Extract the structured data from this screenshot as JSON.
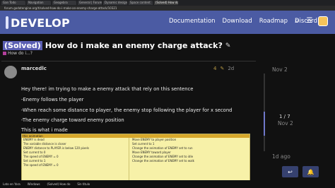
{
  "browser": {
    "tabs": [
      "Gan Todo",
      "Navigation",
      "Geogebra",
      "General | Forum",
      "Dynamic design",
      "Space content",
      "(Solved) How do i make"
    ],
    "url": "forum.godotengine.org/t/solved-how-do-i-make-an-enemy-charge-attack/10321"
  },
  "site": {
    "logo_text": "DEVELOP",
    "nav": [
      "Documentation",
      "Download",
      "Roadmap",
      "Discord"
    ]
  },
  "topic": {
    "solved_badge": "(Solved)",
    "title": "How do i make an enemy charge attack?",
    "category": "How do i...?"
  },
  "post": {
    "username": "marcedlc",
    "likes": "4",
    "age": "2d",
    "lines": [
      "Hey there! im trying to make a enemy attack that rely on this sentence",
      "-Enemy follows the player",
      "-When reach some distance to player, the enemy stop following the player for x second",
      "-The enemy charge toward enemy position",
      "This is what i made"
    ]
  },
  "timeline": {
    "date_top": "Nov 2",
    "count": "1 / 7",
    "date_current": "Nov 2",
    "bottom": "1d ago"
  },
  "image_block": {
    "header": "this animation",
    "left_lines": [
      "ENEMY is dead",
      "The variable distance is closer",
      "ENEMY distance to PLAYER is below 120 pixels",
      "Set current to 0",
      "The speed of ENEMY = 0",
      "Set current to 1",
      "The speed of ENEMY = 0"
    ],
    "right_lines": [
      "Move ENEMY to player position",
      "Set current to 1",
      "Change the animation of ENEMY set to run",
      "Move ENEMY toward player",
      "Change the animation of ENEMY set to idle",
      "Change the animation of ENEMY set to walk"
    ]
  },
  "taskbar": [
    "Lato en Yara",
    "Windows",
    "(Solved) How do",
    "Sin titulo"
  ]
}
